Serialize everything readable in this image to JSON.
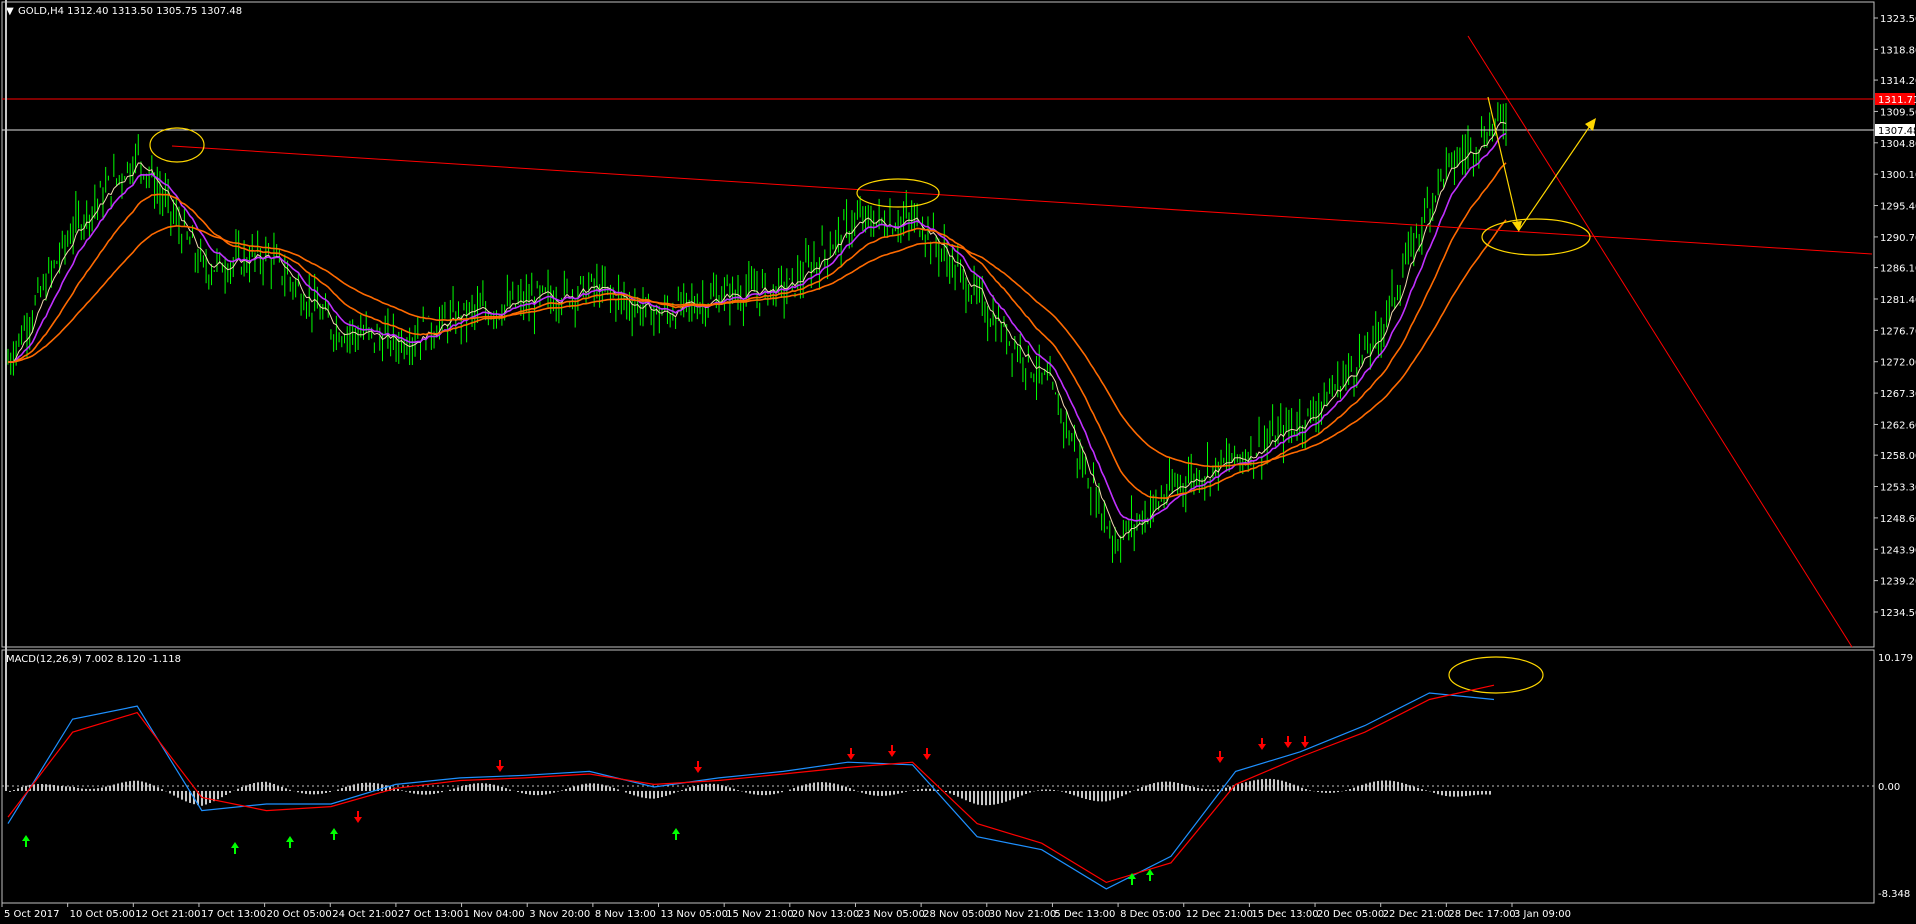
{
  "header": {
    "arrow": "▼",
    "title": "GOLD,H4  1312.40 1313.50 1305.75 1307.48"
  },
  "price_axis": {
    "ticks": [
      "1323.50",
      "1318.80",
      "1314.20",
      "1309.50",
      "1304.80",
      "1300.10",
      "1295.40",
      "1290.70",
      "1286.10",
      "1281.40",
      "1276.70",
      "1272.00",
      "1267.30",
      "1262.60",
      "1258.00",
      "1253.30",
      "1248.60",
      "1243.90",
      "1239.20",
      "1234.50"
    ],
    "current_price_label": "1307.48",
    "level_label": "1311.71",
    "level_color": "#ff0000"
  },
  "macd": {
    "label": "MACD(12,26,9) 7.002 8.120 -1.118",
    "axis_top": "10.179",
    "axis_zero": "0.00",
    "axis_bottom": "-8.348"
  },
  "time_axis": {
    "labels": [
      "5 Oct 2017",
      "10 Oct 05:00",
      "12 Oct 21:00",
      "17 Oct 13:00",
      "20 Oct 05:00",
      "24 Oct 21:00",
      "27 Oct 13:00",
      "1 Nov 04:00",
      "3 Nov 20:00",
      "8 Nov 13:00",
      "13 Nov 05:00",
      "15 Nov 21:00",
      "20 Nov 13:00",
      "23 Nov 05:00",
      "28 Nov 05:00",
      "30 Nov 21:00",
      "5 Dec 13:00",
      "8 Dec 05:00",
      "12 Dec 21:00",
      "15 Dec 13:00",
      "20 Dec 05:00",
      "22 Dec 21:00",
      "28 Dec 17:00",
      "3 Jan 09:00"
    ]
  },
  "chart_data": {
    "type": "line",
    "symbol": "GOLD",
    "timeframe": "H4",
    "ohlc_last": {
      "open": 1312.4,
      "high": 1313.5,
      "low": 1305.75,
      "close": 1307.48
    },
    "ylim": [
      1234.5,
      1323.5
    ],
    "x": [
      "5 Oct 2017",
      "10 Oct 05:00",
      "12 Oct 21:00",
      "17 Oct 13:00",
      "20 Oct 05:00",
      "24 Oct 21:00",
      "27 Oct 13:00",
      "1 Nov 04:00",
      "3 Nov 20:00",
      "8 Nov 13:00",
      "13 Nov 05:00",
      "15 Nov 21:00",
      "20 Nov 13:00",
      "23 Nov 05:00",
      "28 Nov 05:00",
      "30 Nov 21:00",
      "5 Dec 13:00",
      "8 Dec 05:00",
      "12 Dec 21:00",
      "15 Dec 13:00",
      "20 Dec 05:00",
      "22 Dec 21:00",
      "28 Dec 17:00",
      "3 Jan 09:00"
    ],
    "price_close": [
      1272,
      1292,
      1303,
      1286,
      1288,
      1277,
      1275,
      1279,
      1281,
      1283,
      1279,
      1282,
      1283,
      1293,
      1293,
      1280,
      1268,
      1245,
      1254,
      1258,
      1264,
      1275,
      1300,
      1309
    ],
    "macd_ylim": [
      -8.348,
      10.179
    ],
    "macd_main": [
      -2.5,
      5.5,
      6.5,
      -1.5,
      -1.0,
      -1.0,
      0.5,
      1.0,
      1.2,
      1.5,
      0.3,
      1.0,
      1.5,
      2.2,
      2.0,
      -3.5,
      -4.5,
      -7.5,
      -5.0,
      1.5,
      3.0,
      5.0,
      7.5,
      7.0
    ],
    "macd_signal": [
      -2.0,
      4.5,
      6.0,
      -0.5,
      -1.5,
      -1.2,
      0.2,
      0.8,
      1.0,
      1.3,
      0.5,
      0.8,
      1.3,
      1.8,
      2.2,
      -2.5,
      -4.0,
      -7.0,
      -5.5,
      0.5,
      2.6,
      4.5,
      7.0,
      8.1
    ],
    "colors": {
      "bull": "#00ff00",
      "ma_fast": "#f2d8b0",
      "ma_mid": "#c030ff",
      "ma_slow": "#ff6a00",
      "trend": "#ff0000",
      "annotation": "#ffd700",
      "macd_main": "#1e90ff",
      "macd_signal": "#ff0000",
      "histogram": "#c8c8c8"
    }
  }
}
